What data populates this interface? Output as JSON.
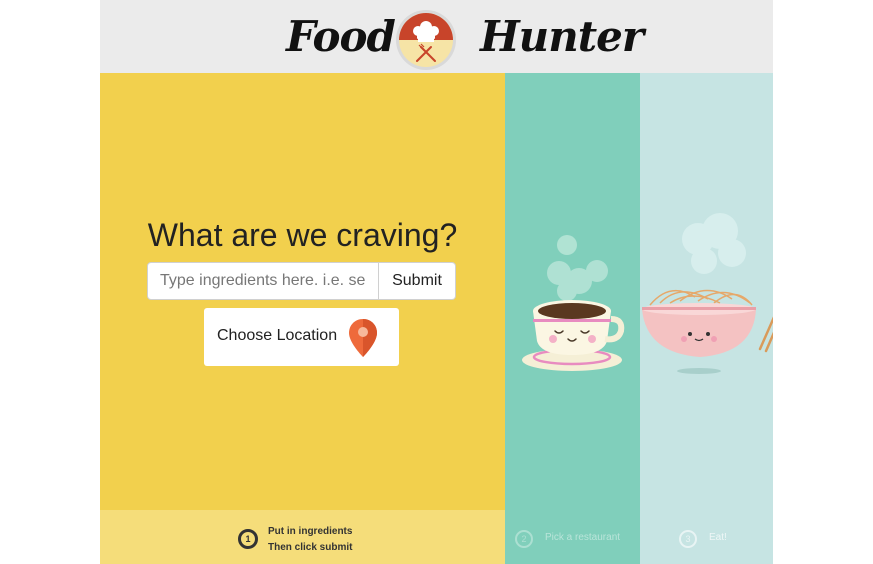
{
  "header": {
    "brand_left": "Food",
    "brand_right": "Hunter",
    "logo_icon": "chef-hat-fork-knife-icon"
  },
  "search": {
    "title": "What are we craving?",
    "input_placeholder": "Type ingredients here. i.e. sea",
    "input_value": "",
    "submit_label": "Submit"
  },
  "location": {
    "label": "Choose Location",
    "icon": "map-pin-icon"
  },
  "steps": [
    {
      "number": "1",
      "line1": "Put in ingredients",
      "line2": "Then click submit"
    },
    {
      "number": "2",
      "text": "Pick a restaurant"
    },
    {
      "number": "3",
      "text": "Eat!"
    }
  ],
  "illustrations": {
    "panel2": "coffee-cup-illustration",
    "panel3": "noodle-bowl-illustration"
  },
  "colors": {
    "header_bg": "#ebebeb",
    "panel1_bg": "#f2d04d",
    "panel2_bg": "#80cfbb",
    "panel3_bg": "#c6e4e3",
    "logo_red": "#c8442a",
    "pin_orange": "#ee6a3b"
  }
}
